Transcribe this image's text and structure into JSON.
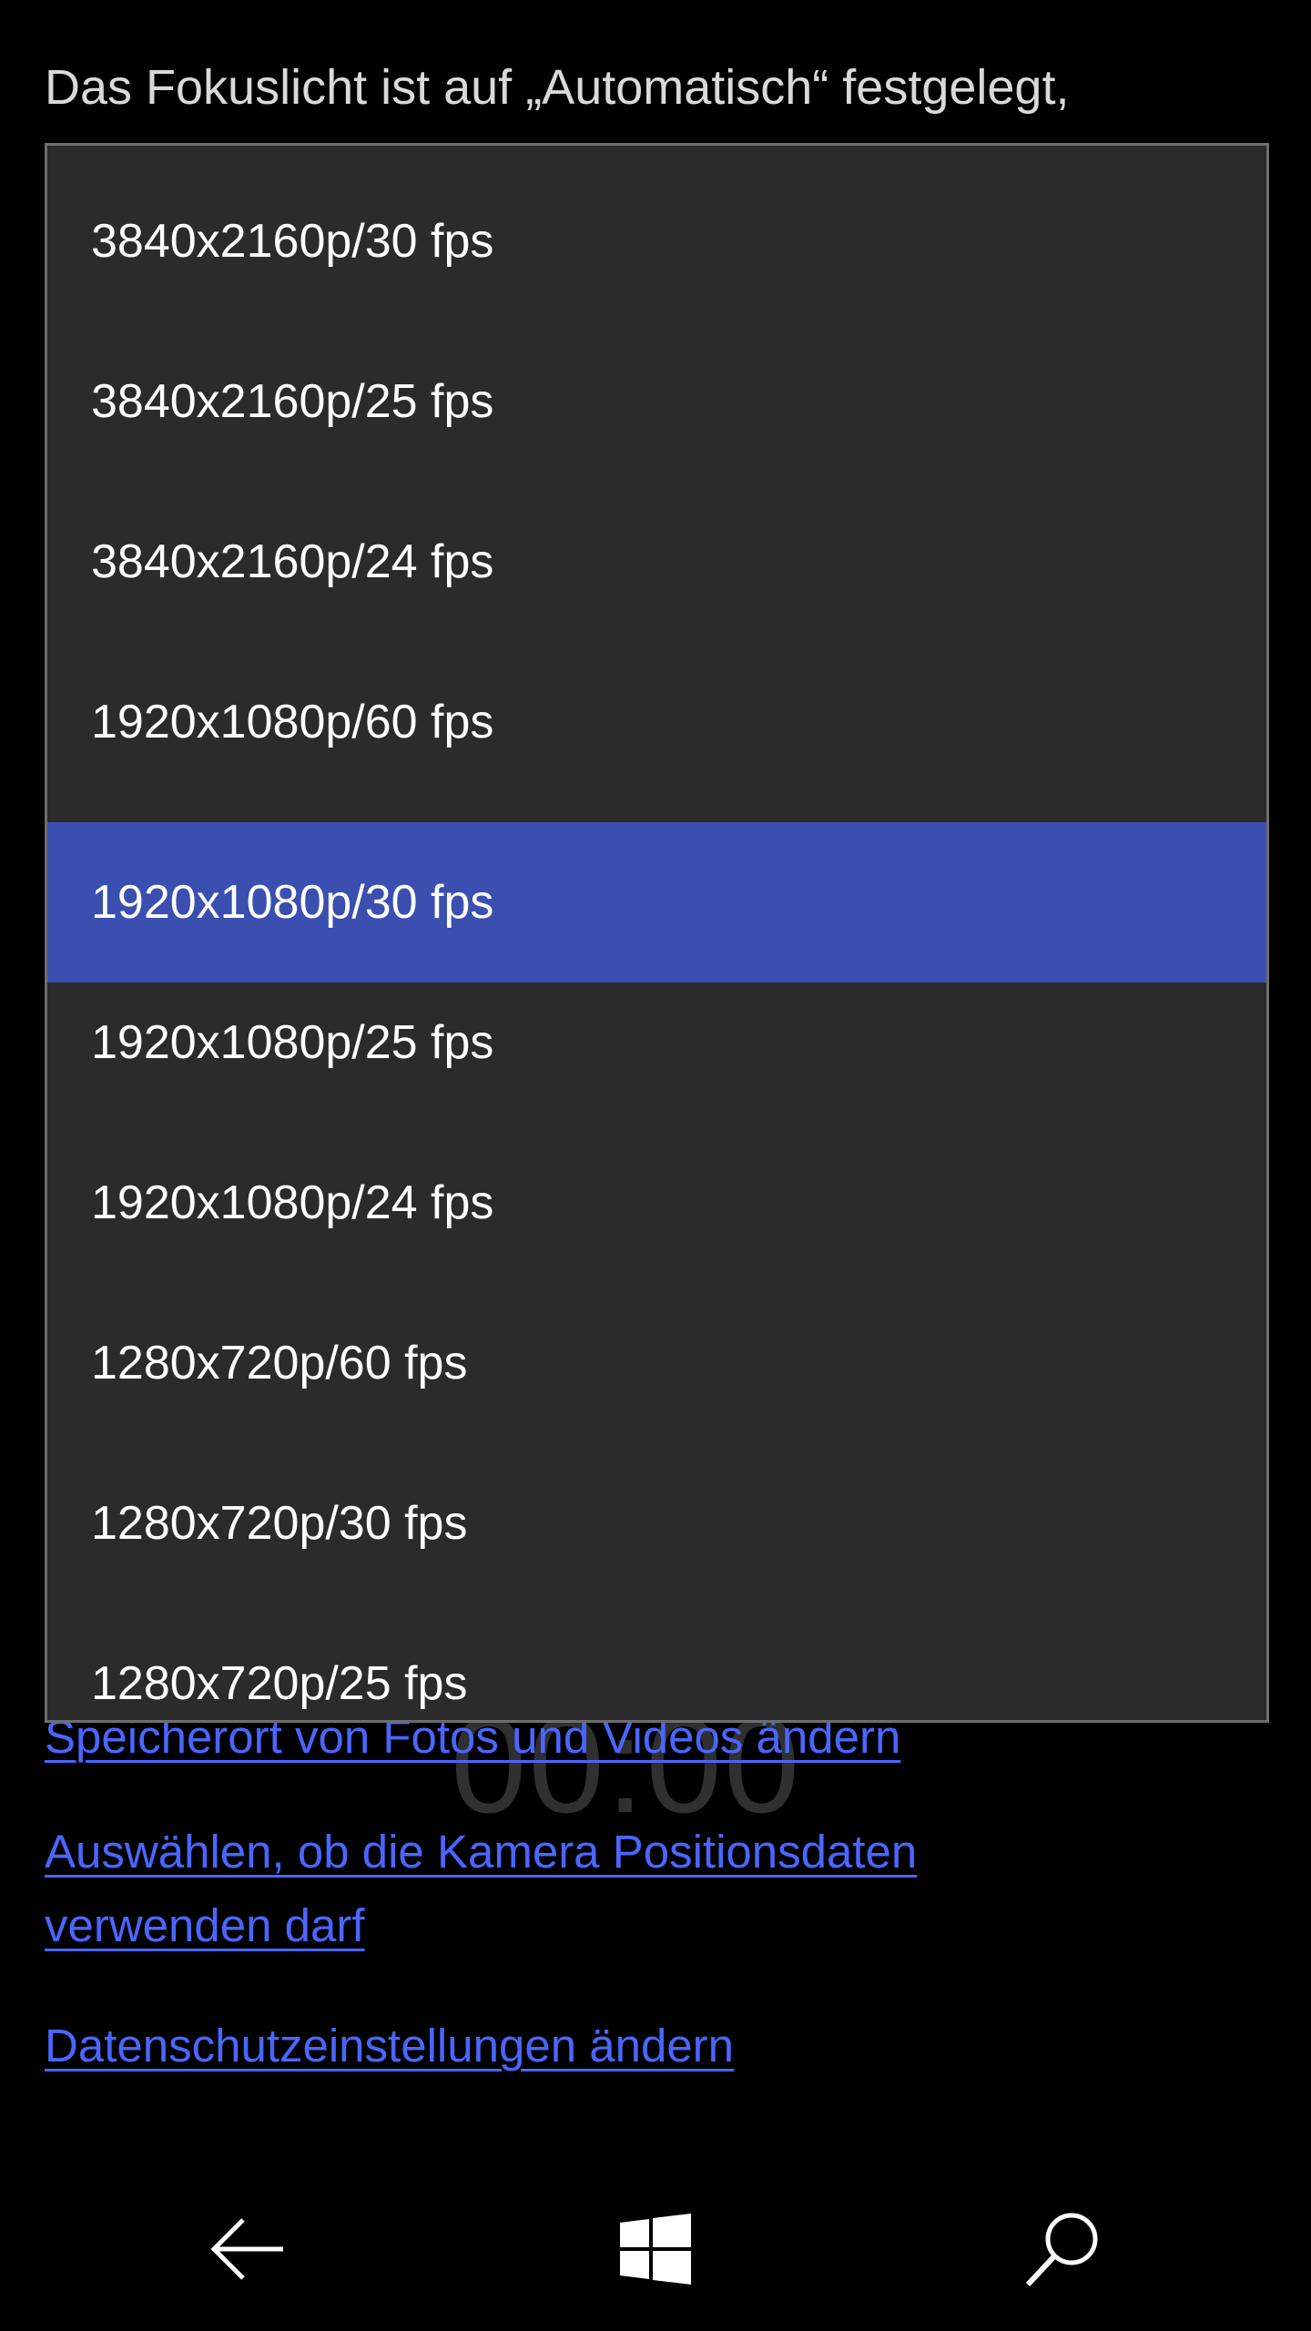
{
  "background": {
    "text_line1": "Das Fokuslicht ist auf „Automatisch“ festgelegt,",
    "timer": "00:00",
    "links": [
      "Speicherort von Fotos und Videos ändern",
      "Auswählen, ob die Kamera Positionsdaten",
      "verwenden darf",
      "Datenschutzeinstellungen ändern"
    ]
  },
  "dropdown": {
    "options": [
      "3840x2160p/30 fps",
      "3840x2160p/25 fps",
      "3840x2160p/24 fps",
      "1920x1080p/60 fps",
      "1920x1080p/30 fps",
      "1920x1080p/25 fps",
      "1920x1080p/24 fps",
      "1280x720p/60 fps",
      "1280x720p/30 fps",
      "1280x720p/25 fps"
    ],
    "selected": "1920x1080p/30 fps"
  },
  "colors": {
    "selected_bg": "#3a4faf",
    "link": "#4a66ff",
    "dropdown_bg": "#2b2b2b"
  },
  "navbar": {
    "icons": [
      "back-arrow-icon",
      "windows-start-icon",
      "search-icon"
    ]
  }
}
